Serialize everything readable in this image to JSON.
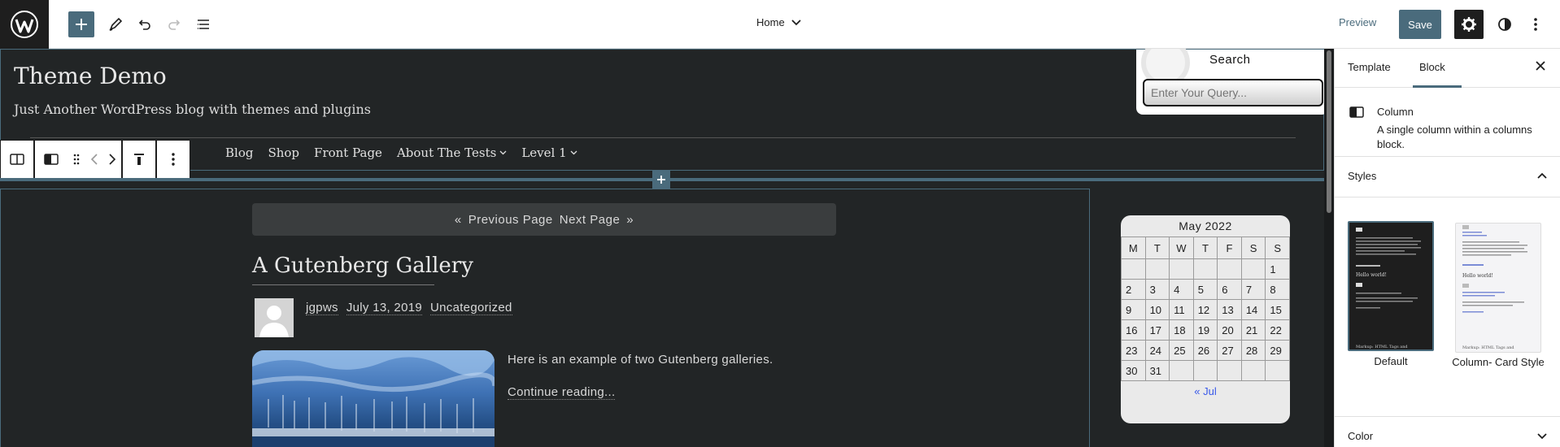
{
  "topbar": {
    "document_title": "Home",
    "preview_label": "Preview",
    "save_label": "Save"
  },
  "site": {
    "title": "Theme Demo",
    "tagline": "Just Another WordPress blog with themes and plugins",
    "nav": [
      {
        "label": "Blog",
        "has_submenu": false
      },
      {
        "label": "Shop",
        "has_submenu": false
      },
      {
        "label": "Front Page",
        "has_submenu": false
      },
      {
        "label": "About The Tests",
        "has_submenu": true
      },
      {
        "label": "Level 1",
        "has_submenu": true
      }
    ],
    "search": {
      "label": "Search",
      "placeholder": "Enter Your Query..."
    }
  },
  "pagination": {
    "prev": "Previous Page",
    "next": "Next Page"
  },
  "post": {
    "title": "A Gutenberg Gallery",
    "author": "jgpws",
    "date": "July 13, 2019",
    "category": "Uncategorized",
    "excerpt": "Here is an example of two Gutenberg galleries.",
    "continue_label": "Continue reading..."
  },
  "calendar": {
    "caption": "May 2022",
    "weekdays": [
      "M",
      "T",
      "W",
      "T",
      "F",
      "S",
      "S"
    ],
    "weeks": [
      [
        "",
        "",
        "",
        "",
        "",
        "",
        "1"
      ],
      [
        "2",
        "3",
        "4",
        "5",
        "6",
        "7",
        "8"
      ],
      [
        "9",
        "10",
        "11",
        "12",
        "13",
        "14",
        "15"
      ],
      [
        "16",
        "17",
        "18",
        "19",
        "20",
        "21",
        "22"
      ],
      [
        "23",
        "24",
        "25",
        "26",
        "27",
        "28",
        "29"
      ],
      [
        "30",
        "31",
        "",
        "",
        "",
        "",
        ""
      ]
    ],
    "prev_link": "« Jul"
  },
  "sidebar": {
    "tabs": [
      "Template",
      "Block"
    ],
    "active_tab": "Block",
    "block": {
      "name": "Column",
      "description": "A single column within a columns block."
    },
    "styles_title": "Styles",
    "styles": [
      {
        "label": "Default",
        "selected": true
      },
      {
        "label": "Column- Card Style",
        "selected": false
      }
    ],
    "color_title": "Color"
  },
  "colors": {
    "accent": "#4a6b7c",
    "canvas_bg": "#222526",
    "link": "#3858e9"
  }
}
